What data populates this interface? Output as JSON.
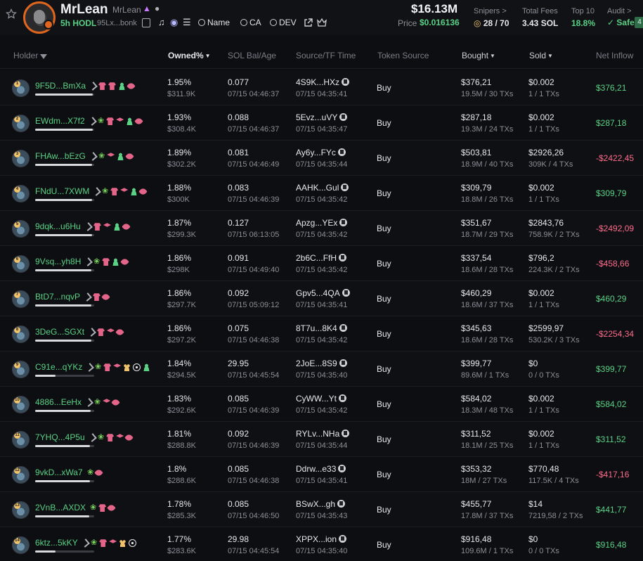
{
  "token": {
    "name": "MrLean",
    "ticker": "MrLean",
    "age": "5h",
    "hodl_label": "HODL",
    "address": "95Lx...bonk",
    "market_cap": "$16.13M",
    "price_label": "Price",
    "price": "$0.016136",
    "links": {
      "name": "Name",
      "ca": "CA",
      "dev": "DEV"
    }
  },
  "stats": {
    "snipers_label": "Snipers >",
    "snipers": "28 / 70",
    "fees_label": "Total Fees",
    "fees": "3.43 SOL",
    "top10_label": "Top 10",
    "top10": "18.8%",
    "audit_label": "Audit >",
    "audit": "Safe",
    "audit_count": "4"
  },
  "columns": {
    "holder": "Holder",
    "owned": "Owned%",
    "sol": "SOL Bal/Age",
    "source": "Source/TF Time",
    "token_source": "Token Source",
    "bought": "Bought",
    "sold": "Sold",
    "net": "Net Inflow"
  },
  "rows": [
    {
      "rank": "1",
      "holder": "9F5D...BmXa",
      "tags": [
        "pen",
        "shirt",
        "shirt",
        "person",
        "fish"
      ],
      "bar": 0.98,
      "pct": "1.95%",
      "usd": "$311.9K",
      "sol": "0.077",
      "age": "07/15 04:46:37",
      "src": "4S9K...HXz",
      "tf": "07/15 04:35:41",
      "type": "Buy",
      "bought": "$376,21",
      "bought_sub": "19.5M / 30 TXs",
      "sold": "$0.002",
      "sold_sub": "1 / 1 TXs",
      "net": "$376,21",
      "net_dir": "pos"
    },
    {
      "rank": "2",
      "holder": "EWdm...X7f2",
      "tags": [
        "pen",
        "sprout",
        "shirt",
        "stack",
        "person",
        "fish"
      ],
      "bar": 0.98,
      "pct": "1.93%",
      "usd": "$308.4K",
      "sol": "0.088",
      "age": "07/15 04:46:37",
      "src": "5Evz...uVY",
      "tf": "07/15 04:35:47",
      "type": "Buy",
      "bought": "$287,18",
      "bought_sub": "19.3M / 24 TXs",
      "sold": "$0.002",
      "sold_sub": "1 / 1 TXs",
      "net": "$287,18",
      "net_dir": "pos"
    },
    {
      "rank": "3",
      "holder": "FHAw...bEzG",
      "tags": [
        "pen",
        "sprout",
        "stack",
        "person",
        "fish"
      ],
      "bar": 0.97,
      "pct": "1.89%",
      "usd": "$302.2K",
      "sol": "0.081",
      "age": "07/15 04:46:49",
      "src": "Ay6y...FYc",
      "tf": "07/15 04:35:44",
      "type": "Buy",
      "bought": "$503,81",
      "bought_sub": "18.9M / 40 TXs",
      "sold": "$2926,26",
      "sold_sub": "309K / 4 TXs",
      "net": "-$2422,45",
      "net_dir": "neg"
    },
    {
      "rank": "4",
      "holder": "FNdU...7XWM",
      "tags": [
        "pen",
        "sprout",
        "shirt",
        "stack",
        "person",
        "fish"
      ],
      "bar": 0.96,
      "pct": "1.88%",
      "usd": "$300K",
      "sol": "0.083",
      "age": "07/15 04:46:39",
      "src": "AAHK...Gul",
      "tf": "07/15 04:35:42",
      "type": "Buy",
      "bought": "$309,79",
      "bought_sub": "18.8M / 26 TXs",
      "sold": "$0.002",
      "sold_sub": "1 / 1 TXs",
      "net": "$309,79",
      "net_dir": "pos"
    },
    {
      "rank": "5",
      "holder": "9dqk...u6Hu",
      "tags": [
        "pen",
        "shirt",
        "stack",
        "person",
        "fish"
      ],
      "bar": 0.96,
      "pct": "1.87%",
      "usd": "$299.3K",
      "sol": "0.127",
      "age": "07/15 06:13:05",
      "src": "Apzg...YEx",
      "tf": "07/15 04:35:42",
      "type": "Buy",
      "bought": "$351,67",
      "bought_sub": "18.7M / 29 TXs",
      "sold": "$2843,76",
      "sold_sub": "758.9K / 2 TXs",
      "net": "-$2492,09",
      "net_dir": "neg"
    },
    {
      "rank": "6",
      "holder": "9Vsq...yh8H",
      "tags": [
        "pen",
        "sprout",
        "shirt",
        "person",
        "fish"
      ],
      "bar": 0.95,
      "pct": "1.86%",
      "usd": "$298K",
      "sol": "0.091",
      "age": "07/15 04:49:40",
      "src": "2b6C...FfH",
      "tf": "07/15 04:35:42",
      "type": "Buy",
      "bought": "$337,54",
      "bought_sub": "18.6M / 28 TXs",
      "sold": "$796,2",
      "sold_sub": "224.3K / 2 TXs",
      "net": "-$458,66",
      "net_dir": "neg"
    },
    {
      "rank": "7",
      "holder": "BtD7...nqvP",
      "tags": [
        "pen",
        "shirt",
        "fish"
      ],
      "bar": 0.95,
      "pct": "1.86%",
      "usd": "$297.7K",
      "sol": "0.092",
      "age": "07/15 05:09:12",
      "src": "Gpv5...4QA",
      "tf": "07/15 04:35:41",
      "type": "Buy",
      "bought": "$460,29",
      "bought_sub": "18.6M / 37 TXs",
      "sold": "$0.002",
      "sold_sub": "1 / 1 TXs",
      "net": "$460,29",
      "net_dir": "pos"
    },
    {
      "rank": "8",
      "holder": "3DeG...SGXt",
      "tags": [
        "pen",
        "shirt",
        "stack",
        "fish"
      ],
      "bar": 0.95,
      "pct": "1.86%",
      "usd": "$297.2K",
      "sol": "0.075",
      "age": "07/15 04:46:38",
      "src": "8T7u...8K4",
      "tf": "07/15 04:35:42",
      "type": "Buy",
      "bought": "$345,63",
      "bought_sub": "18.6M / 28 TXs",
      "sold": "$2599,97",
      "sold_sub": "530.2K / 3 TXs",
      "net": "-$2254,34",
      "net_dir": "neg"
    },
    {
      "rank": "9",
      "holder": "C91e...qYKz",
      "tags": [
        "pen",
        "sprout",
        "shirt",
        "stack",
        "group",
        "target",
        "person"
      ],
      "bar": 0.35,
      "pct": "1.84%",
      "usd": "$294.5K",
      "sol": "29.95",
      "age": "07/15 04:45:54",
      "src": "2JoE...8S9",
      "tf": "07/15 04:35:40",
      "type": "Buy",
      "bought": "$399,77",
      "bought_sub": "89.6M / 1 TXs",
      "sold": "$0",
      "sold_sub": "0 / 0 TXs",
      "net": "$399,77",
      "net_dir": "pos"
    },
    {
      "rank": "10",
      "holder": "4886...EeHx",
      "tags": [
        "pen",
        "sprout",
        "stack",
        "fish"
      ],
      "bar": 0.94,
      "pct": "1.83%",
      "usd": "$292.6K",
      "sol": "0.085",
      "age": "07/15 04:46:39",
      "src": "CyWW...Yt",
      "tf": "07/15 04:35:42",
      "type": "Buy",
      "bought": "$584,02",
      "bought_sub": "18.3M / 48 TXs",
      "sold": "$0.002",
      "sold_sub": "1 / 1 TXs",
      "net": "$584,02",
      "net_dir": "pos"
    },
    {
      "rank": "11",
      "holder": "7YHQ...4P5u",
      "tags": [
        "pen",
        "sprout",
        "shirt",
        "stack",
        "fish"
      ],
      "bar": 0.93,
      "pct": "1.81%",
      "usd": "$288.8K",
      "sol": "0.092",
      "age": "07/15 04:46:39",
      "src": "RYLv...NHa",
      "tf": "07/15 04:35:44",
      "type": "Buy",
      "bought": "$311,52",
      "bought_sub": "18.1M / 25 TXs",
      "sold": "$0.002",
      "sold_sub": "1 / 1 TXs",
      "net": "$311,52",
      "net_dir": "pos"
    },
    {
      "rank": "12",
      "holder": "9vkD...xWa7",
      "tags": [
        "sprout",
        "fish"
      ],
      "bar": 0.93,
      "pct": "1.8%",
      "usd": "$288.6K",
      "sol": "0.085",
      "age": "07/15 04:46:38",
      "src": "Ddrw...e33",
      "tf": "07/15 04:35:41",
      "type": "Buy",
      "bought": "$353,32",
      "bought_sub": "18M / 27 TXs",
      "sold": "$770,48",
      "sold_sub": "117.5K / 4 TXs",
      "net": "-$417,16",
      "net_dir": "neg"
    },
    {
      "rank": "13",
      "holder": "2VnB...AXDX",
      "tags": [
        "sprout",
        "shirt",
        "fish"
      ],
      "bar": 0.92,
      "pct": "1.78%",
      "usd": "$285.3K",
      "sol": "0.085",
      "age": "07/15 04:46:50",
      "src": "BSwX...gh",
      "tf": "07/15 04:35:43",
      "type": "Buy",
      "bought": "$455,77",
      "bought_sub": "17.8M / 37 TXs",
      "sold": "$14",
      "sold_sub": "7219,58 / 2 TXs",
      "net": "$441,77",
      "net_dir": "pos"
    },
    {
      "rank": "14",
      "holder": "6ktz...5kKY",
      "tags": [
        "pen",
        "sprout",
        "shirt",
        "stack",
        "group",
        "target"
      ],
      "bar": 0.35,
      "pct": "1.77%",
      "usd": "$283.6K",
      "sol": "29.98",
      "age": "07/15 04:45:54",
      "src": "XPPX...ion",
      "tf": "07/15 04:35:40",
      "type": "Buy",
      "bought": "$916,48",
      "bought_sub": "109.6M / 1 TXs",
      "sold": "$0",
      "sold_sub": "0 / 0 TXs",
      "net": "$916,48",
      "net_dir": "pos"
    }
  ]
}
